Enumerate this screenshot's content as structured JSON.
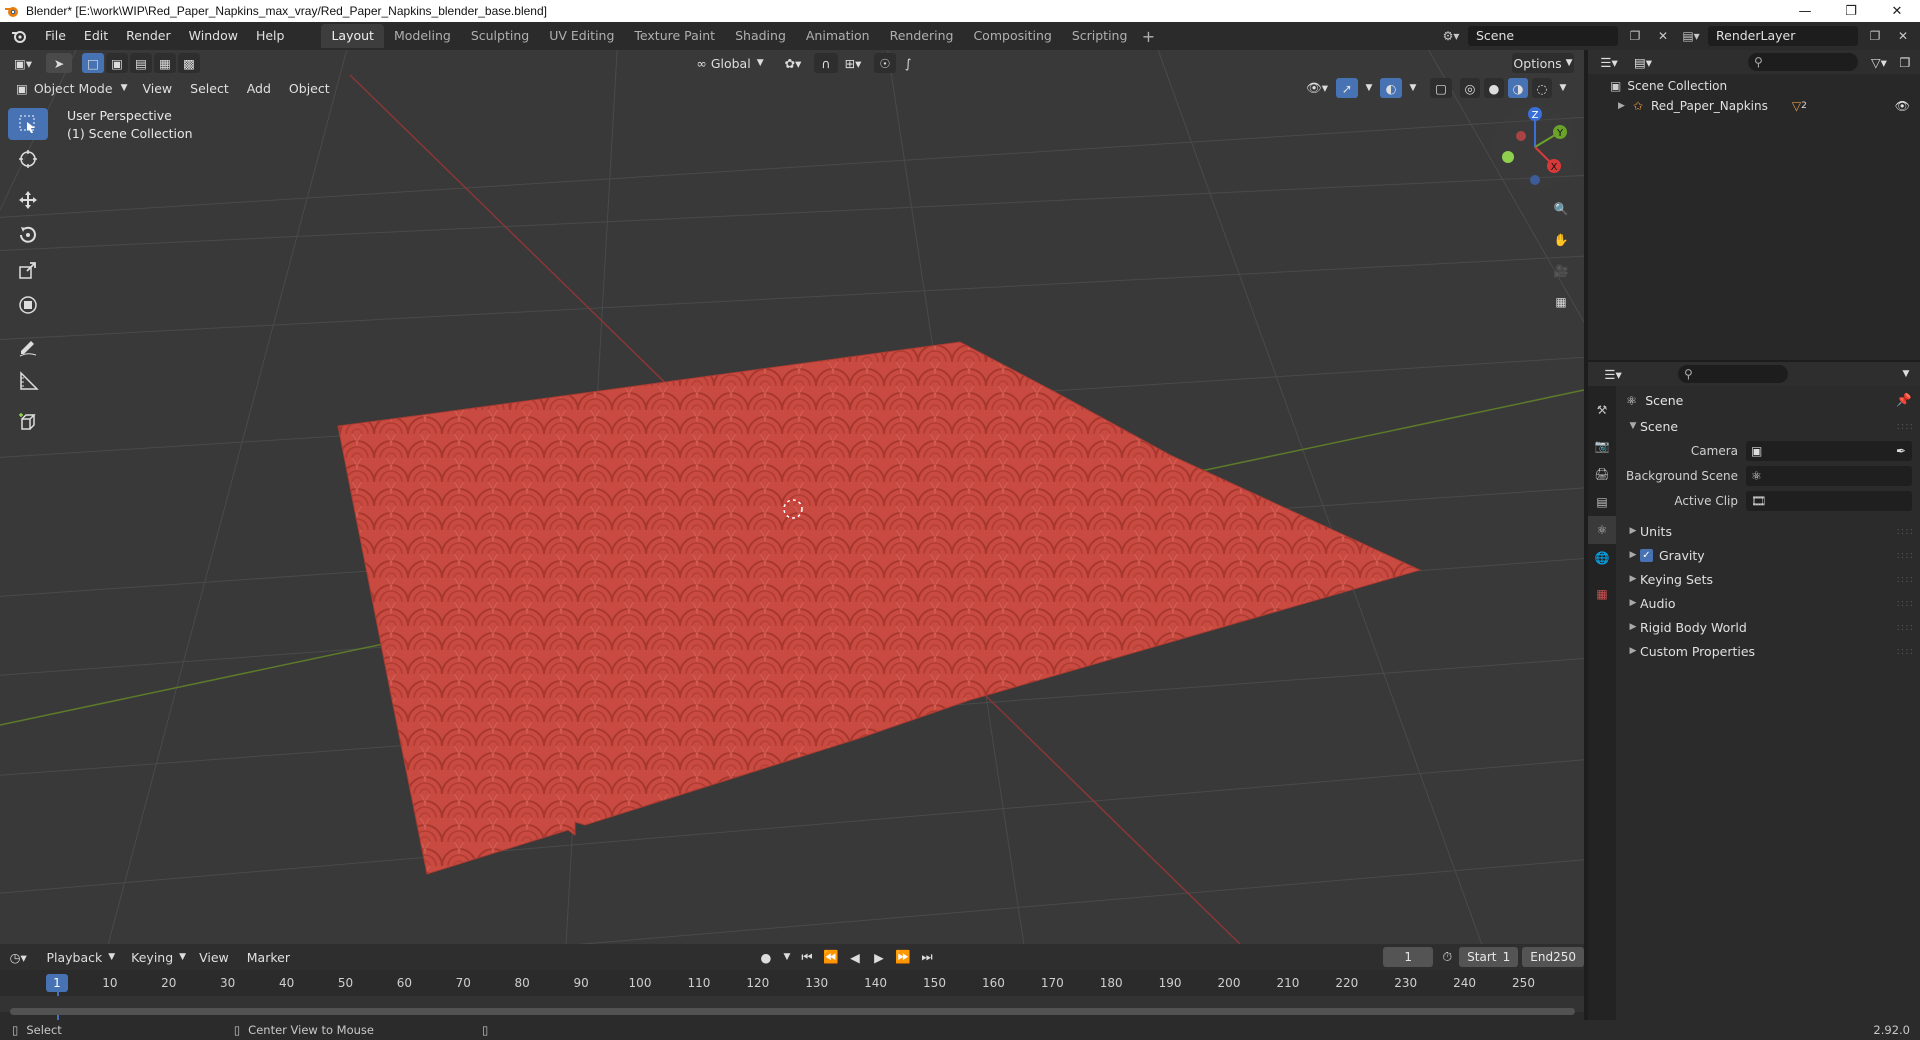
{
  "window": {
    "title": "Blender* [E:\\work\\WIP\\Red_Paper_Napkins_max_vray/Red_Paper_Napkins_blender_base.blend]"
  },
  "menus": [
    "File",
    "Edit",
    "Render",
    "Window",
    "Help"
  ],
  "workspaces": [
    {
      "label": "Layout",
      "active": true
    },
    {
      "label": "Modeling"
    },
    {
      "label": "Sculpting"
    },
    {
      "label": "UV Editing"
    },
    {
      "label": "Texture Paint"
    },
    {
      "label": "Shading"
    },
    {
      "label": "Animation"
    },
    {
      "label": "Rendering"
    },
    {
      "label": "Compositing"
    },
    {
      "label": "Scripting"
    }
  ],
  "topbar": {
    "scene": "Scene",
    "view_layer": "RenderLayer"
  },
  "viewport": {
    "orientation": "Global",
    "options_label": "Options",
    "mode": "Object Mode",
    "header_menus": [
      "View",
      "Select",
      "Add",
      "Object"
    ],
    "overlay_line1": "User Perspective",
    "overlay_line2": "(1) Scene Collection",
    "object_color": "#c94a41"
  },
  "gizmo": {
    "x": "X",
    "y": "Y",
    "z": "Z"
  },
  "outliner": {
    "root": "Scene Collection",
    "object": "Red_Paper_Napkins",
    "object_badge": "2"
  },
  "properties": {
    "context": "Scene",
    "panel": "Scene",
    "camera_label": "Camera",
    "background_scene_label": "Background Scene",
    "active_clip_label": "Active Clip",
    "subpanels": [
      "Units",
      "Gravity",
      "Keying Sets",
      "Audio",
      "Rigid Body World",
      "Custom Properties"
    ]
  },
  "timeline": {
    "menus": [
      "Playback",
      "Keying",
      "View",
      "Marker"
    ],
    "current_frame": "1",
    "start_label": "Start",
    "start": "1",
    "end_label": "End",
    "end": "250",
    "ruler": [
      "1",
      "10",
      "20",
      "30",
      "40",
      "50",
      "60",
      "70",
      "80",
      "90",
      "100",
      "110",
      "120",
      "130",
      "140",
      "150",
      "160",
      "170",
      "180",
      "190",
      "200",
      "210",
      "220",
      "230",
      "240",
      "250"
    ]
  },
  "statusbar": {
    "left": "Select",
    "middle": "Center View to Mouse",
    "version": "2.92.0"
  }
}
